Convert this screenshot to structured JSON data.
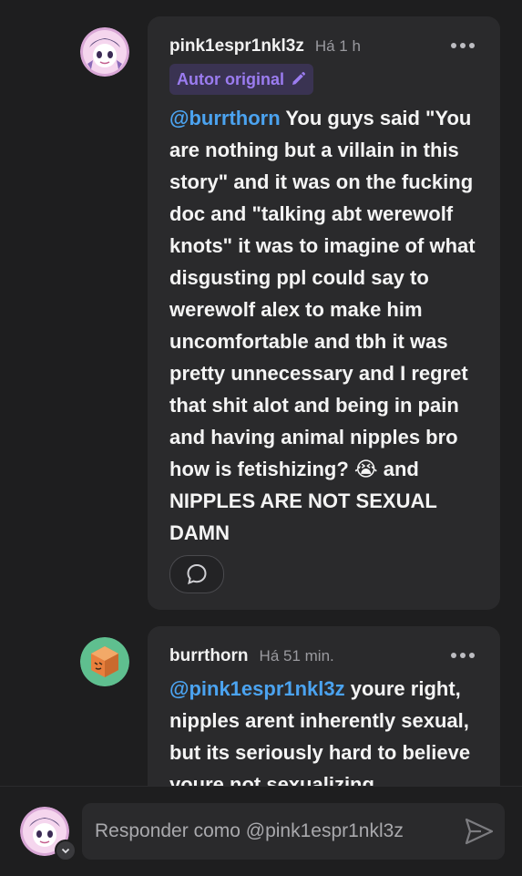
{
  "comments": [
    {
      "username": "pink1espr1nkl3z",
      "time": "Há 1 h",
      "badge": "Autor original",
      "mention": "@burrthorn",
      "text": " You guys said \"You are nothing but a villain in this story\" and it was on the fucking doc and \"talking abt werewolf knots\" it was to imagine of what disgusting ppl could say to werewolf alex to make him uncomfortable and tbh it was pretty unnecessary and I regret that shit alot and being in pain and having animal nipples bro how is fetishizing? 😭 and NIPPLES ARE NOT SEXUAL DAMN"
    },
    {
      "username": "burrthorn",
      "time": "Há 51 min.",
      "mention": "@pink1espr1nkl3z",
      "text": " youre right, nipples arent inherently sexual, but its seriously hard to believe youre not sexualizing"
    }
  ],
  "composer": {
    "placeholder": "Responder como @pink1espr1nkl3z"
  },
  "icons": {
    "more": "more-horizontal-icon",
    "edit": "pencil-icon",
    "reply": "speech-bubble-icon",
    "send": "send-arrow-icon",
    "chevron": "chevron-down-icon"
  },
  "colors": {
    "background": "#1e1e1f",
    "card": "#2a2a2c",
    "mention": "#4ba3f0",
    "badge_text": "#9b7cf0",
    "badge_bg": "#3a3352"
  }
}
